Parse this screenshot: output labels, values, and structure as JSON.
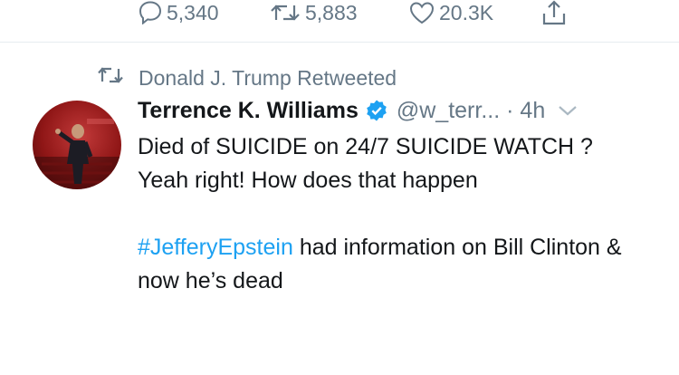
{
  "actions": {
    "reply_count": "5,340",
    "retweet_count": "5,883",
    "like_count": "20.3K",
    "icons": [
      "reply-icon",
      "retweet-icon",
      "like-icon",
      "share-icon"
    ]
  },
  "retweet_banner": {
    "text": "Donald J. Trump Retweeted",
    "icon": "retweet-icon"
  },
  "tweet": {
    "author_name": "Terrence K. Williams",
    "verified": true,
    "handle": "@w_terr...",
    "time": "· 4h",
    "line1": "Died of SUICIDE on 24/7 SUICIDE WATCH ? Yeah right! How does that happen",
    "hashtag": "#JefferyEpstein",
    "line2_rest": " had information on Bill Clinton & now he’s dead"
  },
  "colors": {
    "text": "#14171a",
    "secondary": "#657786",
    "link": "#1da1f2",
    "divider": "#e6ecf0"
  }
}
